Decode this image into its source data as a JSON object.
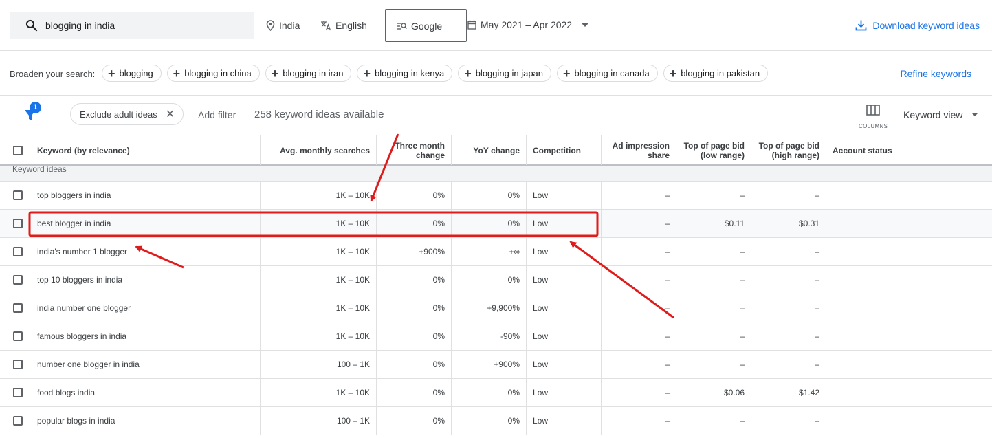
{
  "search": {
    "query": "blogging in india"
  },
  "location": "India",
  "language": "English",
  "network": "Google",
  "date_range": "May 2021 – Apr 2022",
  "download_label": "Download keyword ideas",
  "broaden": {
    "label": "Broaden your search:",
    "chips": [
      "blogging",
      "blogging in china",
      "blogging in iran",
      "blogging in kenya",
      "blogging in japan",
      "blogging in canada",
      "blogging in pakistan"
    ]
  },
  "refine_label": "Refine keywords",
  "filter_badge": "1",
  "exclude_chip": "Exclude adult ideas",
  "add_filter": "Add filter",
  "available": "258 keyword ideas available",
  "columns_label": "COLUMNS",
  "keyword_view": "Keyword view",
  "table": {
    "headers": {
      "keyword": "Keyword (by relevance)",
      "avg": "Avg. monthly searches",
      "three_month": "Three month change",
      "yoy": "YoY change",
      "competition": "Competition",
      "ad_share": "Ad impression share",
      "bid_low": "Top of page bid (low range)",
      "bid_high": "Top of page bid (high range)",
      "account": "Account status"
    },
    "section": "Keyword ideas",
    "rows": [
      {
        "keyword": "top bloggers in india",
        "avg": "1K – 10K",
        "three_month": "0%",
        "yoy": "0%",
        "competition": "Low",
        "ad_share": "–",
        "bid_low": "–",
        "bid_high": "–"
      },
      {
        "keyword": "best blogger in india",
        "avg": "1K – 10K",
        "three_month": "0%",
        "yoy": "0%",
        "competition": "Low",
        "ad_share": "–",
        "bid_low": "$0.11",
        "bid_high": "$0.31"
      },
      {
        "keyword": "india's number 1 blogger",
        "avg": "1K – 10K",
        "three_month": "+900%",
        "yoy": "+∞",
        "competition": "Low",
        "ad_share": "–",
        "bid_low": "–",
        "bid_high": "–"
      },
      {
        "keyword": "top 10 bloggers in india",
        "avg": "1K – 10K",
        "three_month": "0%",
        "yoy": "0%",
        "competition": "Low",
        "ad_share": "–",
        "bid_low": "–",
        "bid_high": "–"
      },
      {
        "keyword": "india number one blogger",
        "avg": "1K – 10K",
        "three_month": "0%",
        "yoy": "+9,900%",
        "competition": "Low",
        "ad_share": "–",
        "bid_low": "–",
        "bid_high": "–"
      },
      {
        "keyword": "famous bloggers in india",
        "avg": "1K – 10K",
        "three_month": "0%",
        "yoy": "-90%",
        "competition": "Low",
        "ad_share": "–",
        "bid_low": "–",
        "bid_high": "–"
      },
      {
        "keyword": "number one blogger in india",
        "avg": "100 – 1K",
        "three_month": "0%",
        "yoy": "+900%",
        "competition": "Low",
        "ad_share": "–",
        "bid_low": "–",
        "bid_high": "–"
      },
      {
        "keyword": "food blogs india",
        "avg": "1K – 10K",
        "three_month": "0%",
        "yoy": "0%",
        "competition": "Low",
        "ad_share": "–",
        "bid_low": "$0.06",
        "bid_high": "$1.42"
      },
      {
        "keyword": "popular blogs in india",
        "avg": "100 – 1K",
        "three_month": "0%",
        "yoy": "0%",
        "competition": "Low",
        "ad_share": "–",
        "bid_low": "–",
        "bid_high": "–"
      }
    ]
  },
  "colors": {
    "accent": "#1a73e8",
    "annotation": "#e01b1b"
  }
}
